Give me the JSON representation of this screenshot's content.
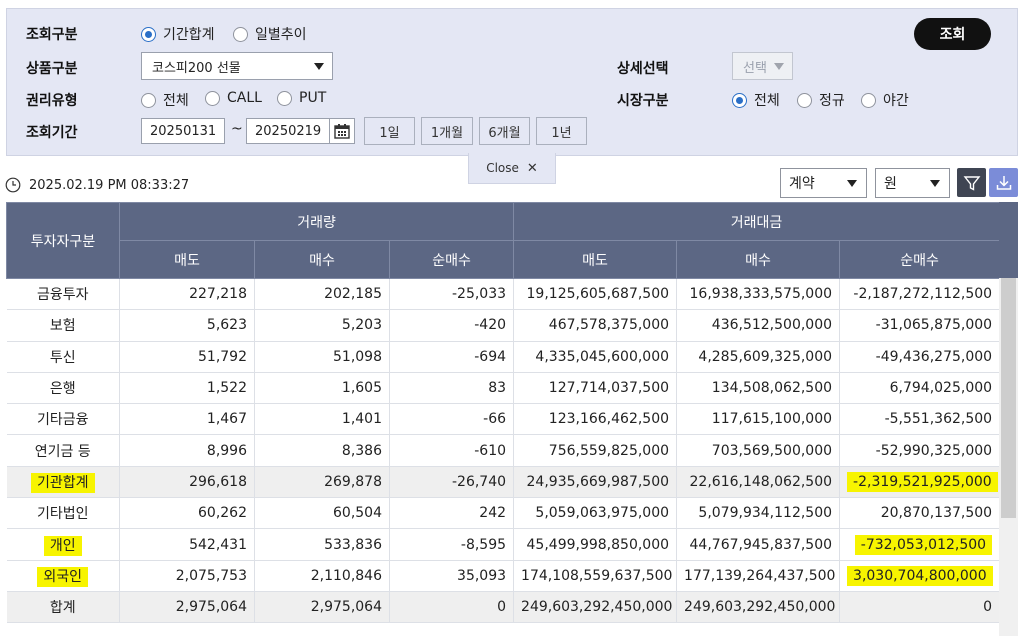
{
  "filter": {
    "search_button": "조회",
    "query_type": {
      "label": "조회구분",
      "options": [
        "기간합계",
        "일별추이"
      ],
      "selected": "기간합계"
    },
    "product": {
      "label": "상품구분",
      "value": "코스피200 선물"
    },
    "right_type": {
      "label": "권리유형",
      "options": [
        "전체",
        "CALL",
        "PUT"
      ],
      "selected": "전체"
    },
    "period": {
      "label": "조회기간",
      "from": "20250131",
      "separator": "~",
      "to": "20250219",
      "quick_buttons": [
        "1일",
        "1개월",
        "6개월",
        "1년"
      ]
    },
    "detail": {
      "label": "상세선택",
      "value": "선택"
    },
    "market": {
      "label": "시장구분",
      "options": [
        "전체",
        "정규",
        "야간"
      ],
      "selected": "전체"
    },
    "close_label": "Close",
    "close_icon": "close-icon"
  },
  "toolbar": {
    "timestamp": "2025.02.19 PM 08:33:27",
    "unit_select": "계약",
    "currency_select": "원",
    "icons": [
      "clock-icon",
      "filter-icon",
      "download-icon"
    ]
  },
  "table": {
    "group_header": "투자자구분",
    "volume_header": "거래량",
    "amount_header": "거래대금",
    "sub_headers": [
      "매도",
      "매수",
      "순매수",
      "매도",
      "매수",
      "순매수"
    ],
    "rows": [
      {
        "name": "금융투자",
        "cells": [
          "227,218",
          "202,185",
          "-25,033",
          "19,125,605,687,500",
          "16,938,333,575,000",
          "-2,187,272,112,500"
        ]
      },
      {
        "name": "보험",
        "cells": [
          "5,623",
          "5,203",
          "-420",
          "467,578,375,000",
          "436,512,500,000",
          "-31,065,875,000"
        ]
      },
      {
        "name": "투신",
        "cells": [
          "51,792",
          "51,098",
          "-694",
          "4,335,045,600,000",
          "4,285,609,325,000",
          "-49,436,275,000"
        ]
      },
      {
        "name": "은행",
        "cells": [
          "1,522",
          "1,605",
          "83",
          "127,714,037,500",
          "134,508,062,500",
          "6,794,025,000"
        ]
      },
      {
        "name": "기타금융",
        "cells": [
          "1,467",
          "1,401",
          "-66",
          "123,166,462,500",
          "117,615,100,000",
          "-5,551,362,500"
        ]
      },
      {
        "name": "연기금 등",
        "cells": [
          "8,996",
          "8,386",
          "-610",
          "756,559,825,000",
          "703,569,500,000",
          "-52,990,325,000"
        ]
      },
      {
        "name": "기관합계",
        "subtotal": true,
        "hl_name": true,
        "hl_net": true,
        "cells": [
          "296,618",
          "269,878",
          "-26,740",
          "24,935,669,987,500",
          "22,616,148,062,500",
          "-2,319,521,925,000"
        ]
      },
      {
        "name": "기타법인",
        "cells": [
          "60,262",
          "60,504",
          "242",
          "5,059,063,975,000",
          "5,079,934,112,500",
          "20,870,137,500"
        ]
      },
      {
        "name": "개인",
        "hl_name": true,
        "hl_net": true,
        "cells": [
          "542,431",
          "533,836",
          "-8,595",
          "45,499,998,850,000",
          "44,767,945,837,500",
          "-732,053,012,500"
        ]
      },
      {
        "name": "외국인",
        "hl_name": true,
        "hl_net": true,
        "cells": [
          "2,075,753",
          "2,110,846",
          "35,093",
          "174,108,559,637,500",
          "177,139,264,437,500",
          "3,030,704,800,000"
        ]
      },
      {
        "name": "합계",
        "subtotal": true,
        "cells": [
          "2,975,064",
          "2,975,064",
          "0",
          "249,603,292,450,000",
          "249,603,292,450,000",
          "0"
        ]
      }
    ]
  },
  "colors": {
    "header_bg": "#5c6784",
    "panel_bg": "#e4e7f4",
    "highlight": "#f7f400",
    "radio_on": "#2a6fc7"
  }
}
